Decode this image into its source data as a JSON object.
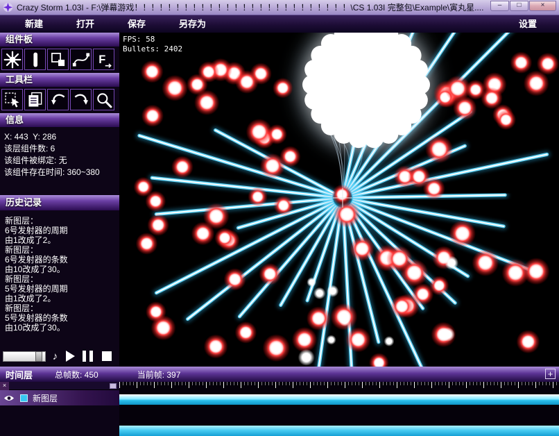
{
  "window": {
    "title": "Crazy Storm 1.03I - F:\\弹幕游戏！！！！！！！！！！！！！！！！！！！！！！！！！！\\CS 1.03I 完整包\\Example\\寅丸星....",
    "controls": {
      "minimize": "–",
      "maximize": "□",
      "close": "×"
    }
  },
  "menu": {
    "new": "新建",
    "open": "打开",
    "save": "保存",
    "save_as": "另存为",
    "settings": "设置"
  },
  "component_panel": {
    "title": "组件板",
    "icons": [
      "emitter-icon",
      "laser-icon",
      "rect-icon",
      "curve-icon",
      "force-field-icon"
    ]
  },
  "tool_panel": {
    "title": "工具栏",
    "icons": [
      "select-icon",
      "copy-icon",
      "undo-icon",
      "redo-icon",
      "zoom-icon"
    ]
  },
  "info_panel": {
    "title": "信息",
    "lines": [
      "X: 443  Y: 286",
      "该层组件数: 6",
      "该组件被绑定: 无",
      "该组件存在时间: 360~380"
    ]
  },
  "history_panel": {
    "title": "历史记录",
    "lines": [
      "新图层：",
      "6号发射器的周期",
      "由1改成了2。",
      "新图层：",
      "6号发射器的条数",
      "由10改成了30。",
      "新图层：",
      "5号发射器的周期",
      "由1改成了2。",
      "新图层：",
      "5号发射器的条数",
      "由10改成了30。"
    ]
  },
  "playback": {
    "icons": [
      "speed-slider",
      "note-icon",
      "play-icon",
      "pause-icon",
      "stop-icon"
    ],
    "note": "♪"
  },
  "canvas": {
    "fps": "FPS: 58",
    "bullets": "Bullets: 2402"
  },
  "timeline": {
    "title": "时间层",
    "total_frames": "总帧数: 450",
    "current_frame": "当前帧: 397",
    "add": "+",
    "close": "×",
    "layer_name": "新图层",
    "accent_color": "#38c8f2"
  }
}
